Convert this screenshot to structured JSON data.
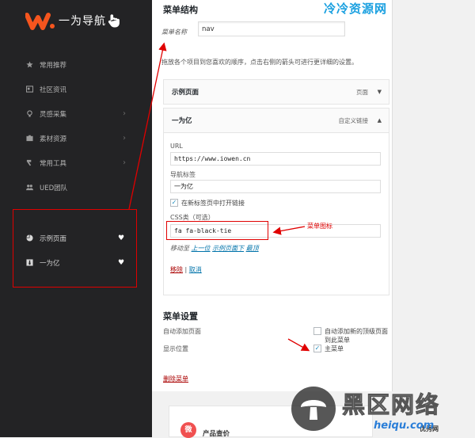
{
  "sidebar": {
    "logo_text": "一为导航",
    "items": [
      {
        "label": "常用推荐",
        "icon": "star-icon",
        "has_chevron": false
      },
      {
        "label": "社区资讯",
        "icon": "news-icon",
        "has_chevron": false
      },
      {
        "label": "灵感采集",
        "icon": "bulb-icon",
        "has_chevron": true
      },
      {
        "label": "素材资源",
        "icon": "box-icon",
        "has_chevron": true
      },
      {
        "label": "常用工具",
        "icon": "hammer-icon",
        "has_chevron": true
      },
      {
        "label": "UED团队",
        "icon": "team-icon",
        "has_chevron": false
      }
    ],
    "custom_items": [
      {
        "label": "示例页面",
        "icon": "pie-chart-icon"
      },
      {
        "label": "一为亿",
        "icon": "black-tie-icon"
      }
    ],
    "heart_glyph": "♥",
    "chevron_glyph": "›"
  },
  "panel": {
    "title": "菜单结构",
    "watermark": "冷冷资源网",
    "menu_name_label": "菜单名称",
    "menu_name_value": "nav",
    "hint": "拖放各个项目到您喜欢的顺序，点击右侧的箭头可进行更详细的设置。",
    "items": [
      {
        "title": "示例页面",
        "type": "页面",
        "arrow": "▼"
      },
      {
        "title": "一为亿",
        "type": "自定义链接",
        "arrow": "▲"
      }
    ],
    "details": {
      "url_label": "URL",
      "url_value": "https://www.iowen.cn",
      "nav_label_label": "导航标签",
      "nav_label_value": "一为亿",
      "new_tab_label": "在新标签页中打开链接",
      "css_label": "CSS类（可选）",
      "css_value": "fa fa-black-tie",
      "move_label": "移动至",
      "move_up": "上一位",
      "move_under": "示例页面下",
      "move_top": "最顶",
      "remove": "移除",
      "separator": "|",
      "cancel": "取消"
    },
    "settings": {
      "title": "菜单设置",
      "auto_add_label": "自动添加页面",
      "auto_add_option": "自动添加新的顶级页面到此菜单",
      "location_label": "显示位置",
      "location_option": "主菜单"
    },
    "delete_menu": "删除菜单",
    "annotation": "菜单图标",
    "check_glyph": "✓"
  },
  "footer": {
    "card_title": "产品查价",
    "card_icon": "微",
    "watermark_cn": "黑区网络",
    "watermark_en": "heiqu.com",
    "right_text": "优秀网"
  },
  "colors": {
    "sidebar_bg": "#232325",
    "accent_red": "#e00000",
    "link_blue": "#0073aa",
    "watermark_blue": "#1aa0e0"
  }
}
